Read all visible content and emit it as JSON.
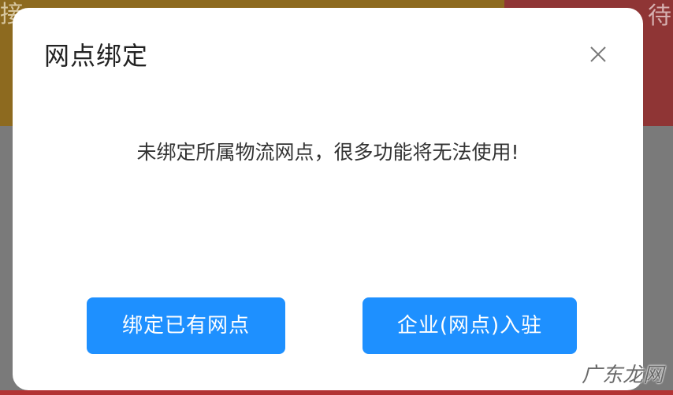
{
  "background": {
    "left_text": "接",
    "right_text": "待"
  },
  "modal": {
    "title": "网点绑定",
    "close_icon": "close-icon",
    "message": "未绑定所属物流网点，很多功能将无法使用!",
    "buttons": {
      "bind_existing": "绑定已有网点",
      "enterprise_join": "企业(网点)入驻"
    }
  },
  "watermark": "广东龙网",
  "colors": {
    "primary_button": "#1e90ff",
    "modal_bg": "#ffffff",
    "title_text": "#222222",
    "message_text": "#333333"
  }
}
